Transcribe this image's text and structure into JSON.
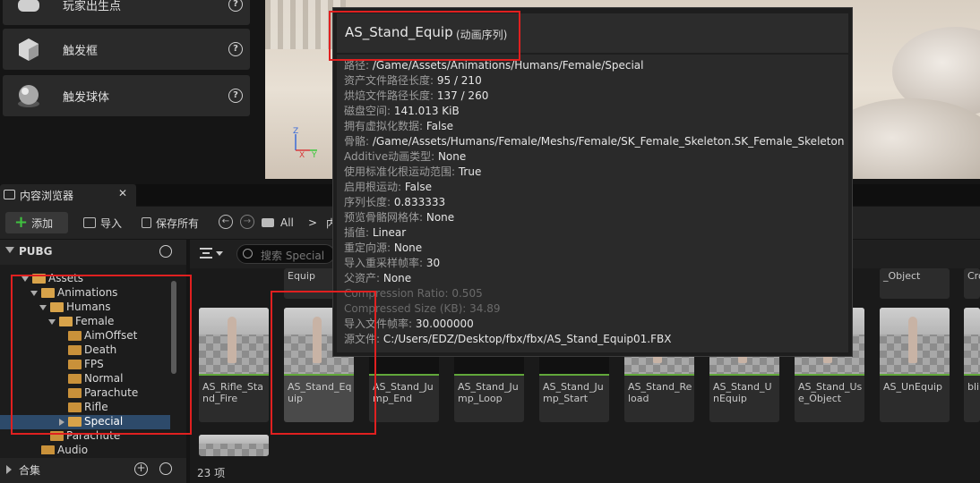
{
  "place_actors": {
    "items": [
      {
        "label": "玩家出生点",
        "icon": "gamepad-icon"
      },
      {
        "label": "触发框",
        "icon": "trigger-box-icon"
      },
      {
        "label": "触发球体",
        "icon": "trigger-sphere-icon"
      }
    ],
    "help_glyph": "?"
  },
  "viewport": {
    "gizmo": {
      "z": "Z",
      "x": "X",
      "y": "Y"
    }
  },
  "content_browser": {
    "tab_label": "内容浏览器",
    "close_glyph": "✕",
    "toolbar": {
      "add_plus": "+",
      "add_label": "添加",
      "import_label": "导入",
      "save_all_label": "保存所有",
      "nav_back": "←",
      "nav_forward": "→",
      "path_all": "All",
      "path_sep": ">",
      "path_cut": "内"
    },
    "sources": {
      "title": "PUBG",
      "tree": [
        {
          "label": "Assets",
          "depth": 0
        },
        {
          "label": "Animations",
          "depth": 1
        },
        {
          "label": "Humans",
          "depth": 2
        },
        {
          "label": "Female",
          "depth": 3
        },
        {
          "label": "AimOffset",
          "depth": 4
        },
        {
          "label": "Death",
          "depth": 4
        },
        {
          "label": "FPS",
          "depth": 4
        },
        {
          "label": "Normal",
          "depth": 4
        },
        {
          "label": "Parachute",
          "depth": 4
        },
        {
          "label": "Rifle",
          "depth": 4
        },
        {
          "label": "Special",
          "depth": 4,
          "selected": true
        },
        {
          "label": "Parachute",
          "depth": 2
        },
        {
          "label": "Audio",
          "depth": 1
        }
      ],
      "collections_label": "合集",
      "collections_add": "+"
    },
    "search_placeholder": "搜索 Special",
    "top_row_tiles": [
      "Equip",
      "_Object",
      "Cro"
    ],
    "tiles": [
      "AS_Rifle_Stand_Fire",
      "AS_Stand_Equip",
      "AS_Stand_Jump_End",
      "AS_Stand_Jump_Loop",
      "AS_Stand_Jump_Start",
      "AS_Stand_Reload",
      "AS_Stand_UnEquip",
      "AS_Stand_Use_Object",
      "AS_UnEquip",
      "blir"
    ],
    "status": "23 项"
  },
  "tooltip": {
    "title": "AS_Stand_Equip",
    "type": "(动画序列)",
    "rows": [
      {
        "k": "路径: ",
        "v": "/Game/Assets/Animations/Humans/Female/Special"
      },
      {
        "k": "资产文件路径长度: ",
        "v": "95 / 210"
      },
      {
        "k": "烘焙文件路径长度: ",
        "v": "137 / 260"
      },
      {
        "k": "磁盘空间: ",
        "v": "141.013 KiB"
      },
      {
        "k": "拥有虚拟化数据: ",
        "v": "False"
      },
      {
        "k": "骨骼: ",
        "v": "/Game/Assets/Humans/Female/Meshs/Female/SK_Female_Skeleton.SK_Female_Skeleton"
      },
      {
        "k": "Additive动画类型: ",
        "v": "None"
      },
      {
        "k": "使用标准化根运动范围: ",
        "v": "True"
      },
      {
        "k": "启用根运动: ",
        "v": "False"
      },
      {
        "k": "序列长度: ",
        "v": "0.833333"
      },
      {
        "k": "预览骨骼网格体: ",
        "v": "None"
      },
      {
        "k": "插值: ",
        "v": "Linear"
      },
      {
        "k": "重定向源: ",
        "v": "None"
      },
      {
        "k": "导入重采样帧率: ",
        "v": "30"
      },
      {
        "k": "父资产: ",
        "v": "None"
      },
      {
        "k": "Compression Ratio: ",
        "v": "0.505",
        "dim": true
      },
      {
        "k": "Compressed Size (KB): ",
        "v": "34.89",
        "dim": true
      },
      {
        "k": "导入文件帧率: ",
        "v": "30.000000"
      },
      {
        "k": "源文件: ",
        "v": "C:/Users/EDZ/Desktop/fbx/fbx/AS_Stand_Equip01.FBX"
      }
    ]
  },
  "colors": {
    "highlight": "#e02020",
    "selection": "#2d4a6a",
    "add_green": "#3fc23f",
    "folder": "#c9913a"
  }
}
